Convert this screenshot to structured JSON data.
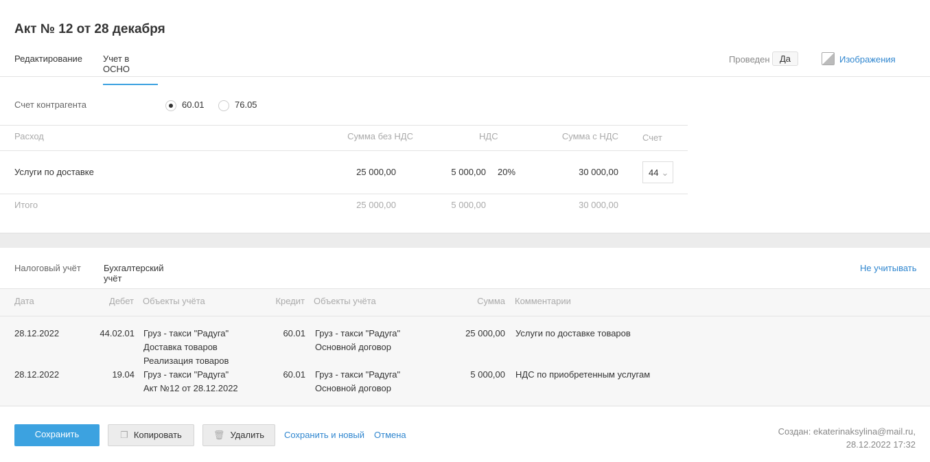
{
  "title": "Акт № 12 от 28 декабря",
  "tabs": [
    "Редактирование",
    "Учет в ОСНО"
  ],
  "status": {
    "label": "Проведен",
    "value": "Да"
  },
  "images_link": "Изображения",
  "counterparty": {
    "label": "Счет контрагента",
    "options": [
      "60.01",
      "76.05"
    ],
    "selected": "60.01"
  },
  "expense_table": {
    "headers": [
      "Расход",
      "Сумма без НДС",
      "НДС",
      "Сумма с НДС",
      "Счет"
    ],
    "row": {
      "name": "Услуги по доставке",
      "net": "25 000,00",
      "vat": "5 000,00",
      "rate": "20%",
      "gross": "30 000,00",
      "account": "44"
    },
    "total": {
      "label": "Итого",
      "net": "25 000,00",
      "vat": "5 000,00",
      "gross": "30 000,00"
    }
  },
  "ledger_tabs": [
    "Налоговый учёт",
    "Бухгалтерский учёт"
  ],
  "ignore_link": "Не учитывать",
  "ledger": {
    "headers": [
      "Дата",
      "Дебет",
      "Объекты учёта",
      "Кредит",
      "Объекты учёта",
      "Сумма",
      "Комментарии"
    ],
    "rows": [
      {
        "date": "28.12.2022",
        "debit": "44.02.01",
        "debit_objects": [
          "Груз - такси \"Радуга\"",
          "Доставка товаров",
          "Реализация товаров"
        ],
        "credit": "60.01",
        "credit_objects": [
          "Груз - такси \"Радуга\"",
          "Основной договор"
        ],
        "sum": "25 000,00",
        "comment": "Услуги по доставке товаров"
      },
      {
        "date": "28.12.2022",
        "debit": "19.04",
        "debit_objects": [
          "Груз - такси \"Радуга\"",
          "Акт №12 от 28.12.2022"
        ],
        "credit": "60.01",
        "credit_objects": [
          "Груз - такси \"Радуга\"",
          "Основной договор"
        ],
        "sum": "5 000,00",
        "comment": "НДС по приобретенным услугам"
      }
    ]
  },
  "buttons": {
    "save": "Сохранить",
    "copy": "Копировать",
    "delete": "Удалить",
    "save_new": "Сохранить и новый",
    "cancel": "Отмена"
  },
  "created": {
    "line1": "Создан: ekaterinaksylina@mail.ru,",
    "line2": "28.12.2022 17:32"
  }
}
